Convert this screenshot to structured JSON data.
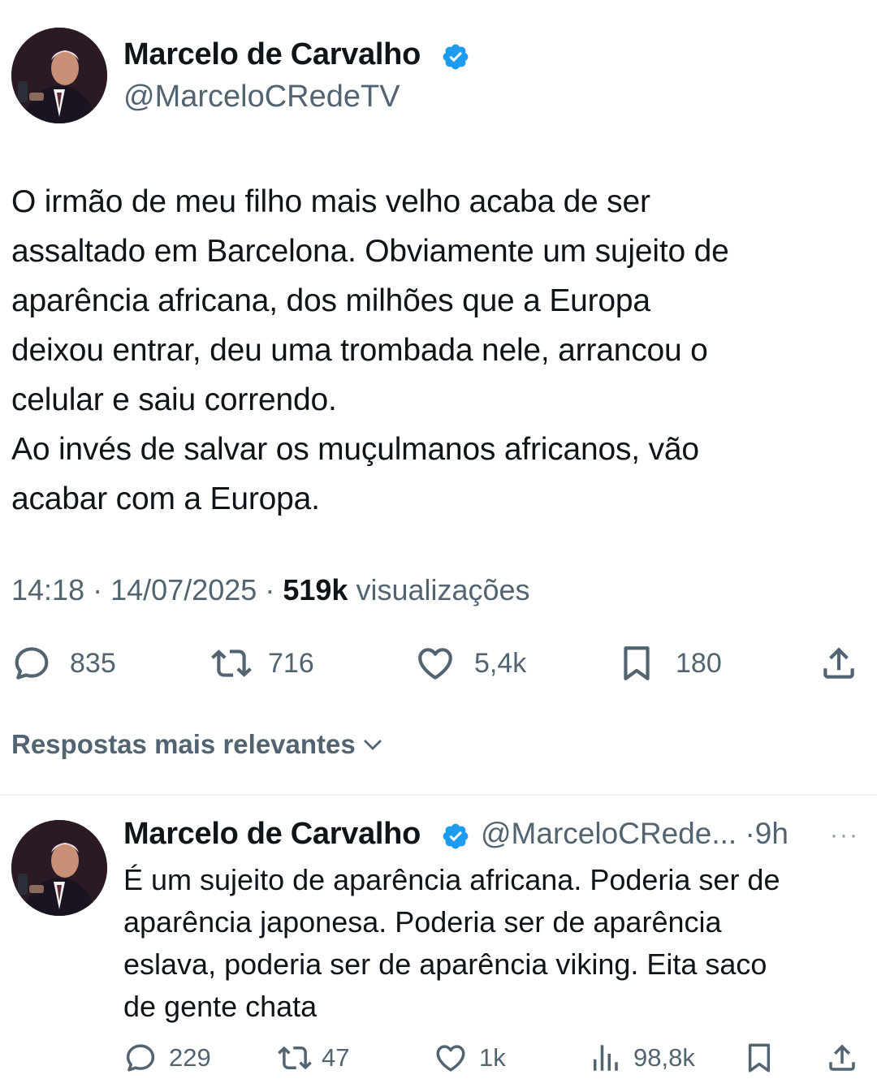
{
  "tweet": {
    "author_name": "Marcelo de Carvalho",
    "author_handle": "@MarceloCRedeTV",
    "text": "O irmão de meu filho mais velho acaba de ser\nassaltado em Barcelona. Obviamente um sujeito de\naparência africana, dos milhões que a Europa\ndeixou entrar, deu uma trombada nele, arrancou o\ncelular e saiu correndo.\nAo invés de salvar os muçulmanos africanos, vão\nacabar com a Europa.",
    "time": "14:18",
    "separator": "·",
    "date": "14/07/2025",
    "views_count": "519k",
    "views_label": "visualizações",
    "replies": "835",
    "reposts": "716",
    "likes": "5,4k",
    "bookmarks": "180"
  },
  "replies_section": {
    "title": "Respostas mais relevantes"
  },
  "reply": {
    "author_name": "Marcelo de Carvalho",
    "author_handle": "@MarceloCRede...",
    "separator": "·",
    "age": "9h",
    "more": "···",
    "text": "É um sujeito de aparência africana. Poderia ser de\naparência japonesa. Poderia ser de aparência\neslava, poderia ser de aparência viking. Eita saco\nde gente chata",
    "replies": "229",
    "reposts": "47",
    "likes": "1k",
    "views": "98,8k"
  },
  "colors": {
    "verified": "#1d9bf0",
    "secondary_text": "#536471",
    "primary_text": "#0f1419"
  },
  "icons": [
    "verified-badge-icon",
    "reply-icon",
    "repost-icon",
    "like-icon",
    "bookmark-icon",
    "share-icon",
    "views-icon",
    "chevron-down-icon",
    "more-icon"
  ]
}
